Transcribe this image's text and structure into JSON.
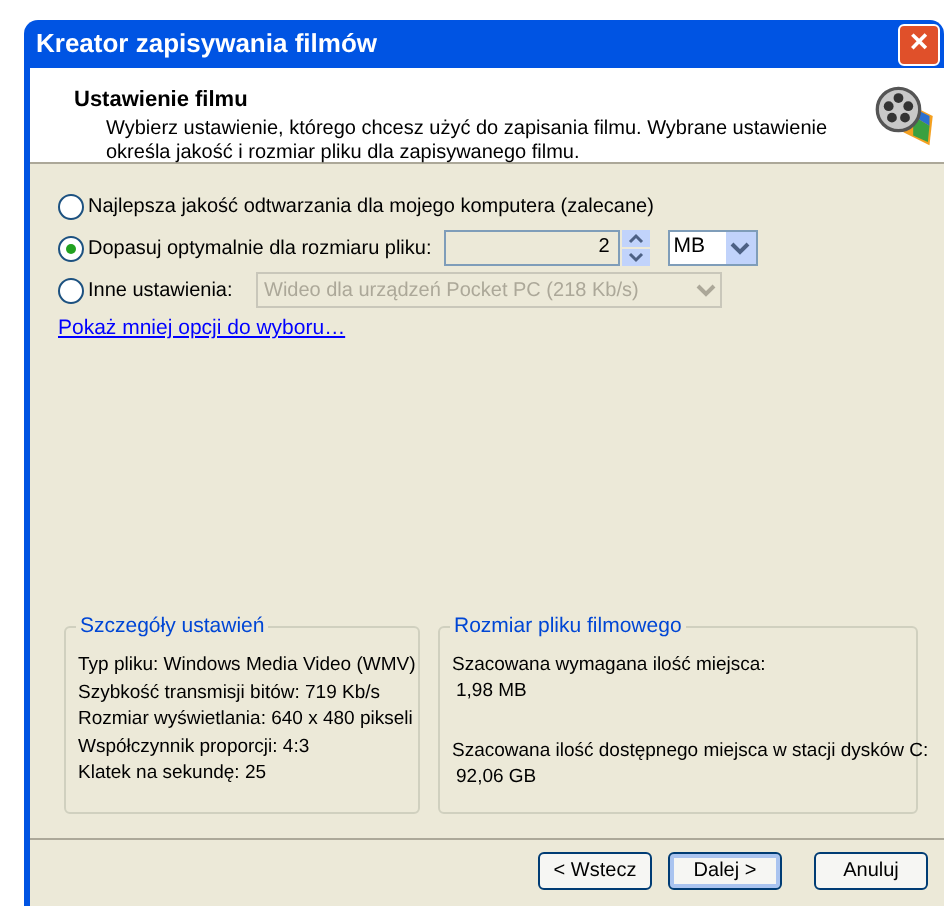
{
  "window": {
    "title": "Kreator zapisywania filmów",
    "close": "×"
  },
  "header": {
    "title": "Ustawienie filmu",
    "description": "Wybierz ustawienie, którego chcesz użyć do zapisania filmu. Wybrane ustawienie określa jakość i rozmiar pliku dla zapisywanego filmu."
  },
  "options": [
    {
      "kind": "plain",
      "label": "Najlepsza jakość odtwarzania dla mojego komputera (zalecane)",
      "selected": false
    },
    {
      "kind": "size",
      "label": "Dopasuj optymalnie dla rozmiaru pliku:",
      "selected": true,
      "value": "2",
      "unit": "MB"
    },
    {
      "kind": "preset",
      "label": "Inne ustawienia:",
      "selected": false,
      "value": "Wideo dla urządzeń Pocket PC (218 Kb/s)"
    }
  ],
  "link": "Pokaż mniej opcji do wyboru…",
  "details": {
    "title": "Szczegóły ustawień",
    "lines": [
      "Typ pliku: Windows Media Video (WMV)",
      "Szybkość transmisji bitów: 719 Kb/s",
      "Rozmiar wyświetlania: 640 x 480 pikseli",
      "Współczynnik proporcji: 4:3",
      "Klatek na sekundę: 25"
    ]
  },
  "file_size": {
    "title": "Rozmiar pliku filmowego",
    "required_label": "Szacowana wymagana ilość miejsca:",
    "required_value": "1,98 MB",
    "available_label": "Szacowana ilość dostępnego miejsca w stacji dysków C:",
    "available_value": "92,06 GB"
  },
  "buttons": [
    "< Wstecz",
    "Dalej >",
    "Anuluj"
  ]
}
